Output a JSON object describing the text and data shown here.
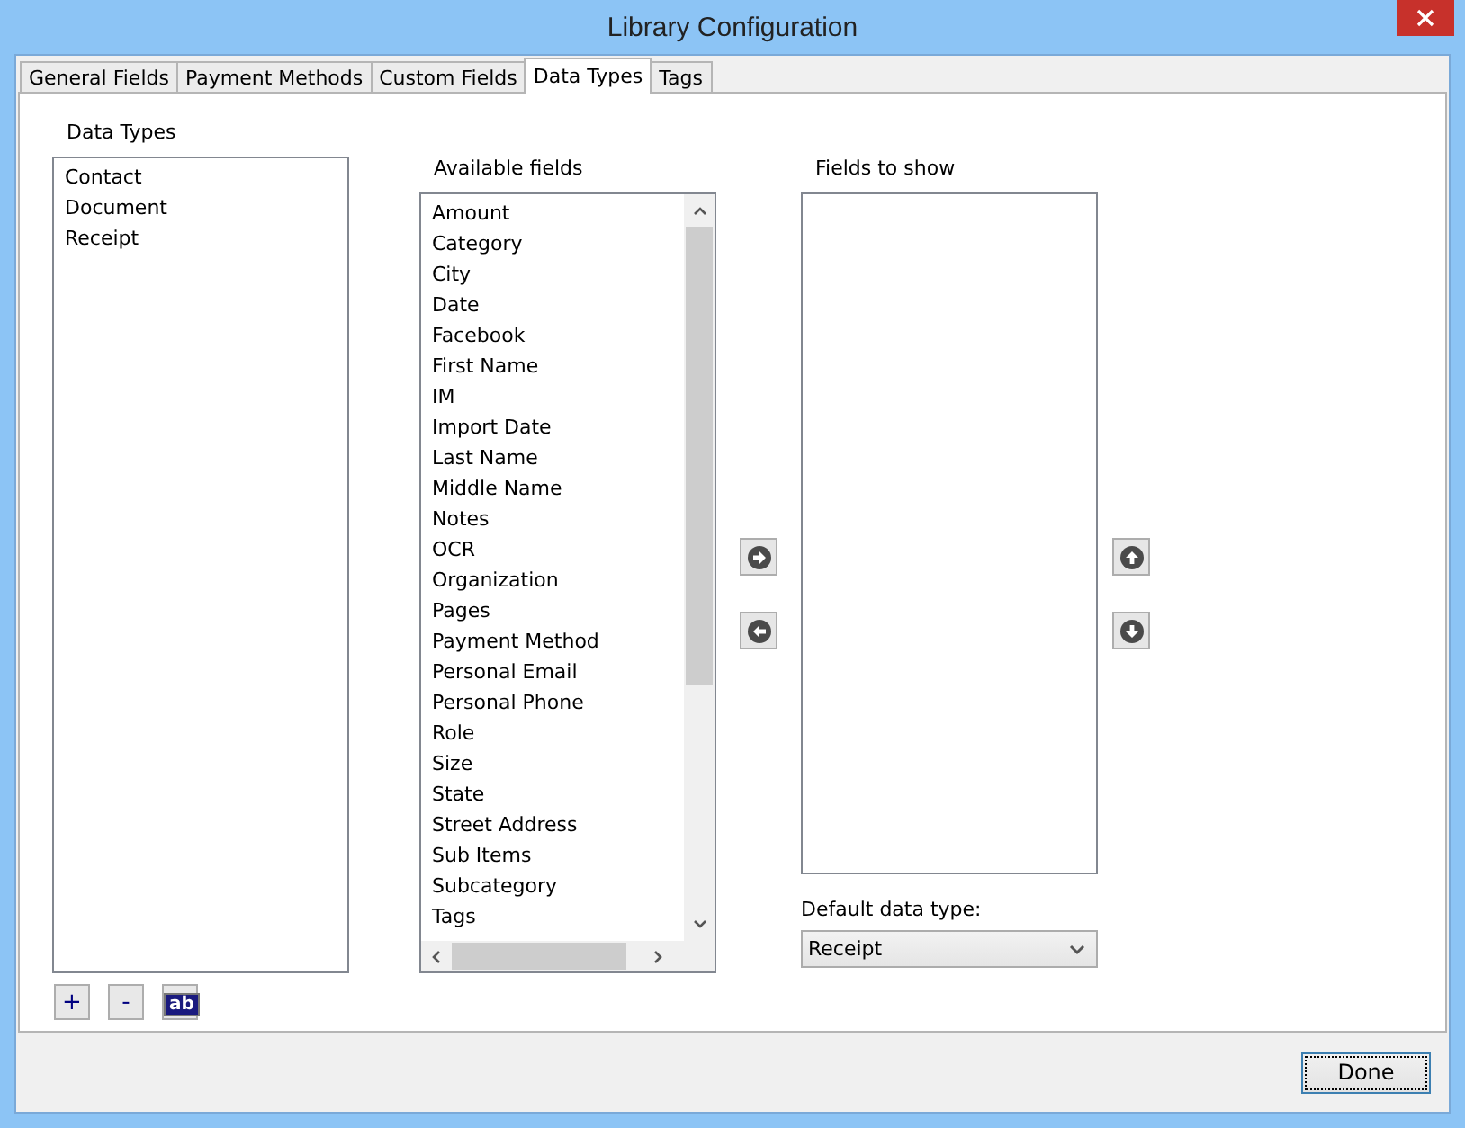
{
  "window": {
    "title": "Library Configuration"
  },
  "tabs": [
    {
      "label": "General Fields",
      "selected": false
    },
    {
      "label": "Payment Methods",
      "selected": false
    },
    {
      "label": "Custom Fields",
      "selected": false
    },
    {
      "label": "Data Types",
      "selected": true
    },
    {
      "label": "Tags",
      "selected": false
    }
  ],
  "data_types": {
    "label": "Data Types",
    "items": [
      "Contact",
      "Document",
      "Receipt"
    ],
    "buttons": [
      "+",
      "-",
      "ab"
    ]
  },
  "available_fields": {
    "label": "Available fields",
    "items": [
      "Amount",
      "Category",
      "City",
      "Date",
      "Facebook",
      "First Name",
      "IM",
      "Import Date",
      "Last Name",
      "Middle Name",
      "Notes",
      "OCR",
      "Organization",
      "Pages",
      "Payment Method",
      "Personal Email",
      "Personal Phone",
      "Role",
      "Size",
      "State",
      "Street Address",
      "Sub Items",
      "Subcategory",
      "Tags"
    ]
  },
  "fields_to_show": {
    "label": "Fields to show"
  },
  "default_data_type": {
    "label": "Default data type:",
    "value": "Receipt"
  },
  "done_button": "Done"
}
